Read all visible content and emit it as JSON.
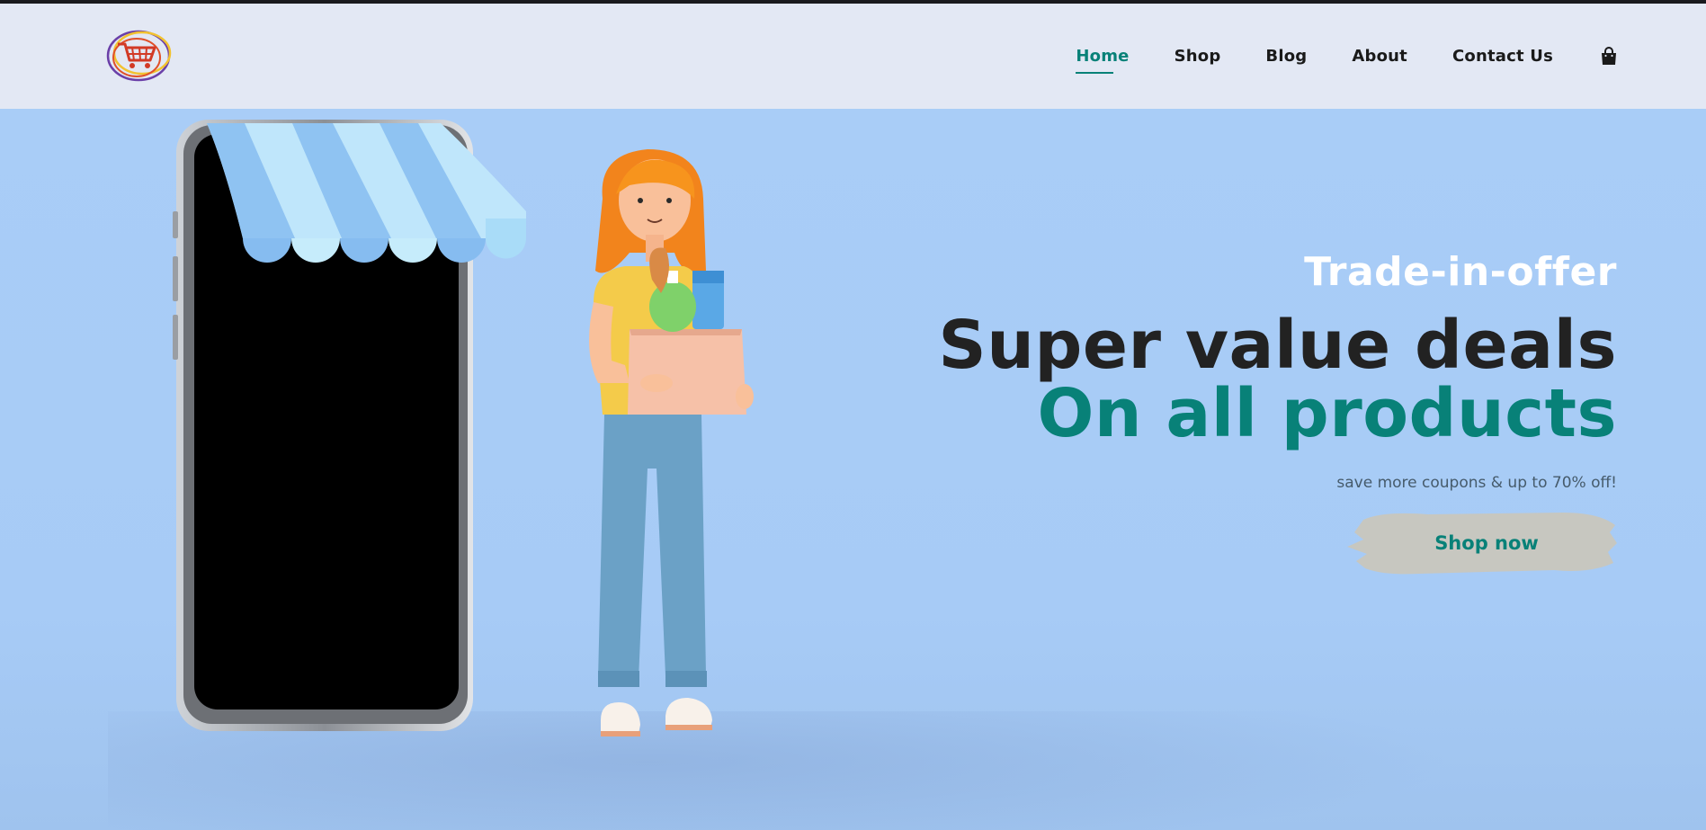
{
  "nav": {
    "items": [
      {
        "label": "Home",
        "active": true
      },
      {
        "label": "Shop",
        "active": false
      },
      {
        "label": "Blog",
        "active": false
      },
      {
        "label": "About",
        "active": false
      },
      {
        "label": "Contact Us",
        "active": false
      }
    ],
    "cart_icon": "shopping-bag-icon",
    "logo_icon": "shopping-cart-logo-icon"
  },
  "hero": {
    "eyebrow": "Trade-in-offer",
    "headline_line1": "Super value deals",
    "headline_line2": "On all products",
    "subtext": "save more coupons & up to 70% off!",
    "cta_label": "Shop now"
  },
  "colors": {
    "accent": "#088178",
    "header_bg": "#e3e8f4",
    "hero_bg": "#a9cdf7",
    "dark_text": "#222222",
    "button_bg": "#c7c7c0"
  }
}
